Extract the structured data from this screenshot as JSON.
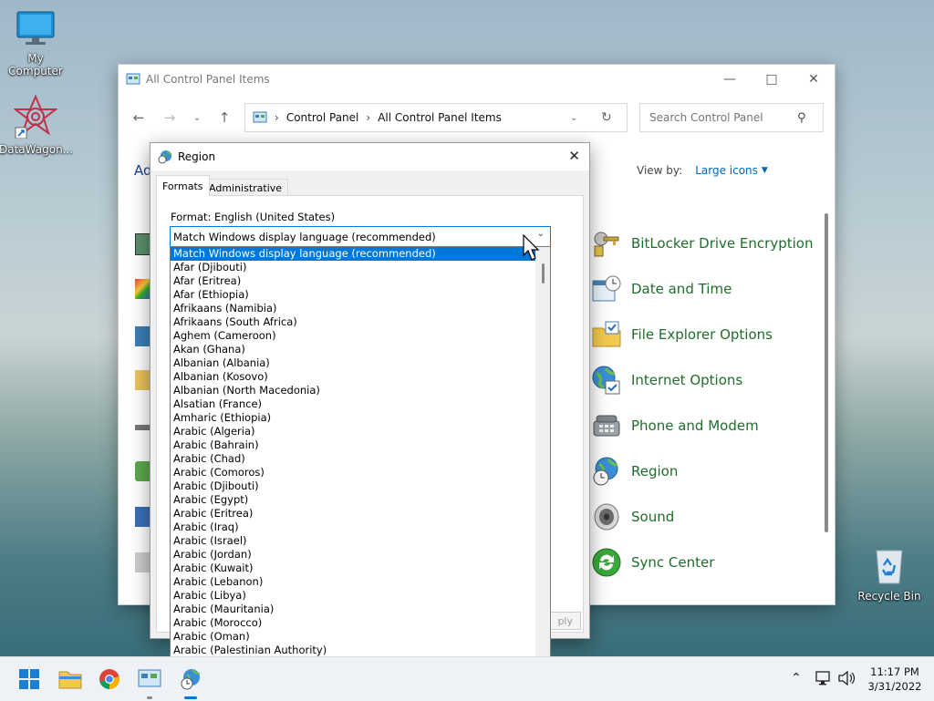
{
  "desktop": {
    "icons": [
      {
        "label": "My Computer"
      },
      {
        "label": "DataWagon..."
      },
      {
        "label": "Recycle Bin"
      }
    ]
  },
  "control_panel": {
    "title": "All Control Panel Items",
    "breadcrumb": [
      "Control Panel",
      "All Control Panel Items"
    ],
    "search_placeholder": "Search Control Panel",
    "heading_fragment": "Ad",
    "view_by_label": "View by:",
    "view_by_value": "Large icons",
    "items": [
      {
        "label": "BitLocker Drive Encryption",
        "icon": "bitlocker-keys-icon"
      },
      {
        "label": "Date and Time",
        "icon": "calendar-clock-icon"
      },
      {
        "label": "File Explorer Options",
        "icon": "folder-check-icon"
      },
      {
        "label": "Internet Options",
        "icon": "globe-check-icon"
      },
      {
        "label": "Phone and Modem",
        "icon": "phone-icon"
      },
      {
        "label": "Region",
        "icon": "globe-clock-icon"
      },
      {
        "label": "Sound",
        "icon": "speaker-icon"
      },
      {
        "label": "Sync Center",
        "icon": "sync-arrows-icon"
      }
    ]
  },
  "region_dialog": {
    "title": "Region",
    "tabs": [
      "Formats",
      "Administrative"
    ],
    "format_label": "Format: English (United States)",
    "selected": "Match Windows display language (recommended)",
    "apply_fragment": "ply",
    "options": [
      "Match Windows display language (recommended)",
      "Afar (Djibouti)",
      "Afar (Eritrea)",
      "Afar (Ethiopia)",
      "Afrikaans (Namibia)",
      "Afrikaans (South Africa)",
      "Aghem (Cameroon)",
      "Akan (Ghana)",
      "Albanian (Albania)",
      "Albanian (Kosovo)",
      "Albanian (North Macedonia)",
      "Alsatian (France)",
      "Amharic (Ethiopia)",
      "Arabic (Algeria)",
      "Arabic (Bahrain)",
      "Arabic (Chad)",
      "Arabic (Comoros)",
      "Arabic (Djibouti)",
      "Arabic (Egypt)",
      "Arabic (Eritrea)",
      "Arabic (Iraq)",
      "Arabic (Israel)",
      "Arabic (Jordan)",
      "Arabic (Kuwait)",
      "Arabic (Lebanon)",
      "Arabic (Libya)",
      "Arabic (Mauritania)",
      "Arabic (Morocco)",
      "Arabic (Oman)",
      "Arabic (Palestinian Authority)"
    ]
  },
  "taskbar": {
    "time": "11:17 PM",
    "date": "3/31/2022"
  },
  "colors": {
    "accent": "#0078d7",
    "cp_link_green": "#1e6e2b",
    "view_by_blue": "#0066b4"
  }
}
